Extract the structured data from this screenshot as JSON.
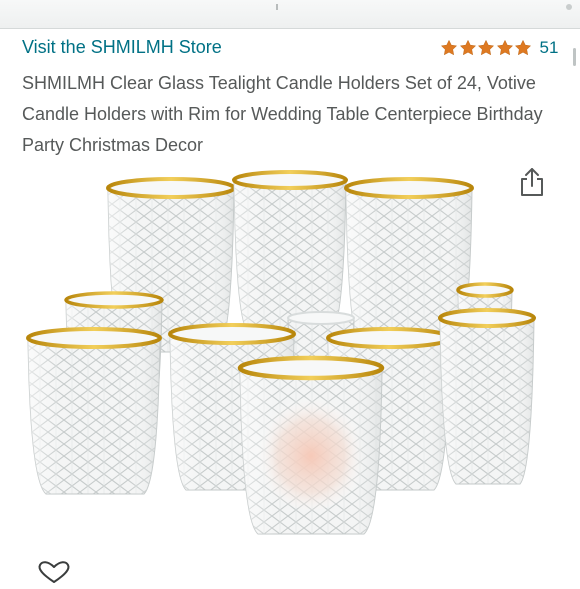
{
  "store": {
    "link_text": "Visit the SHMILMH Store"
  },
  "rating": {
    "stars": 5,
    "count": "51",
    "star_color": "#de7921"
  },
  "product": {
    "title": "SHMILMH Clear Glass Tealight Candle Holders Set of 24, Votive Candle Holders with Rim for Wedding Table Centerpiece Birthday Party Christmas Decor"
  },
  "icons": {
    "share": "share-icon",
    "wishlist": "heart-outline-icon"
  },
  "colors": {
    "link": "#007185",
    "title_text": "#565959",
    "gold_rim": "#d4a018"
  }
}
